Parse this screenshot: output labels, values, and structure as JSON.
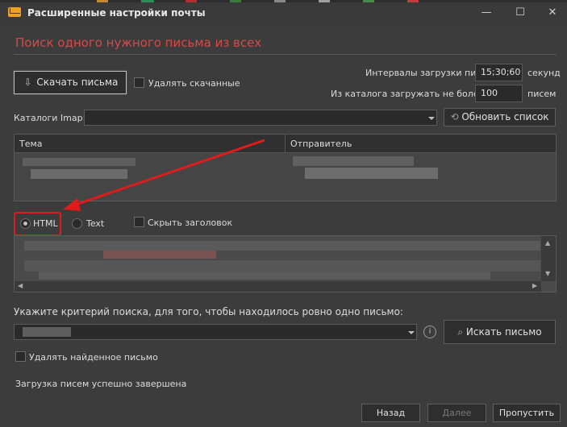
{
  "window": {
    "title": "Расширенные настройки почты",
    "controls": {
      "minimize": "—",
      "maximize": "☐",
      "close": "✕"
    }
  },
  "section": {
    "title": "Поиск одного нужного письма из всех"
  },
  "download": {
    "button_label": "Скачать письма",
    "delete_downloaded_label": "Удалять скачанные",
    "intervals_label": "Интервалы загрузки писем:",
    "intervals_value": "15;30;60",
    "intervals_unit": "секунд",
    "max_label": "Из каталога загружать не более:",
    "max_value": "100",
    "max_unit": "писем"
  },
  "imap": {
    "label": "Каталоги Imap:",
    "value": "",
    "refresh_label": "Обновить список"
  },
  "table": {
    "columns": [
      "Тема",
      "Отправитель"
    ]
  },
  "format": {
    "html_label": "HTML",
    "text_label": "Text",
    "hide_header_label": "Скрыть заголовок",
    "selected": "HTML"
  },
  "search": {
    "prompt": "Укажите критерий поиска, для того, чтобы находилось ровно одно письмо:",
    "value": "",
    "button_label": "Искать письмо",
    "delete_found_label": "Удалять найденное письмо"
  },
  "status": {
    "text": "Загрузка писем успешно завершена"
  },
  "footer": {
    "back": "Назад",
    "next": "Далее",
    "skip": "Пропустить"
  },
  "colors": {
    "accent_title": "#d94848",
    "annotation": "#e01b1b",
    "background": "#3c3c3c"
  }
}
